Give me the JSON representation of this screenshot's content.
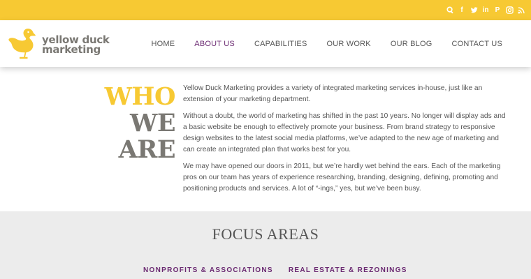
{
  "social": [
    {
      "icon": "search-icon",
      "glyph": ""
    },
    {
      "icon": "facebook-icon",
      "glyph": "f"
    },
    {
      "icon": "twitter-icon",
      "glyph": ""
    },
    {
      "icon": "linkedin-icon",
      "glyph": "in"
    },
    {
      "icon": "pinterest-icon",
      "glyph": "P"
    },
    {
      "icon": "instagram-icon",
      "glyph": ""
    },
    {
      "icon": "rss-icon",
      "glyph": ""
    }
  ],
  "logo": {
    "line1": "yellow duck",
    "line2": "marketing"
  },
  "nav": [
    {
      "label": "HOME"
    },
    {
      "label": "ABOUT US",
      "active": true
    },
    {
      "label": "CAPABILITIES"
    },
    {
      "label": "OUR WORK"
    },
    {
      "label": "OUR BLOG"
    },
    {
      "label": "CONTACT US"
    }
  ],
  "about": {
    "heading_line1": "WHO",
    "heading_line2": "WE ARE",
    "paragraphs": [
      "Yellow Duck Marketing provides a variety of integrated marketing services in-house, just like an extension of your marketing department.",
      "Without a doubt, the world of marketing has shifted in the past 10 years. No longer will display ads and a basic website be enough to effectively promote your business. From brand strategy to responsive design websites to the latest social media platforms, we’ve adapted to the new age of marketing and can create an integrated plan that works best for you.",
      "We may have opened our doors in 2011, but we’re hardly wet behind the ears. Each of the marketing pros on our team has years of experience researching, branding, designing, defining, promoting and positioning products and services. A lot of “-ings,” yes, but we’ve been busy."
    ]
  },
  "focus": {
    "title": "FOCUS AREAS",
    "tags": [
      "NONPROFITS & ASSOCIATIONS",
      "REAL ESTATE & REZONINGS"
    ]
  },
  "colors": {
    "brand_yellow": "#f7c933",
    "brand_gray": "#7a7873",
    "accent_purple": "#6b2a72"
  }
}
